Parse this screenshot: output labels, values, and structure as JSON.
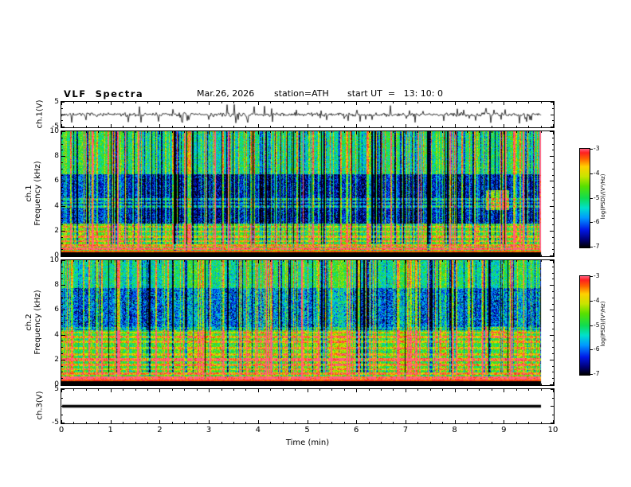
{
  "header": {
    "title": "VLF  Spectra",
    "date": "Mar.26, 2026",
    "station": "station=ATH",
    "start_ut": "start UT  =   13: 10: 0"
  },
  "x_axis": {
    "label": "Time (min)",
    "min": 0,
    "max": 10,
    "ticks": [
      0,
      1,
      2,
      3,
      4,
      5,
      6,
      7,
      8,
      9,
      10
    ],
    "minor_step": 0.25,
    "data_end_min": 9.74
  },
  "colorbars": [
    {
      "label": "log(PSD)/(V²/Hz)",
      "min": -7,
      "max": -3,
      "ticks": [
        -3,
        -4,
        -5,
        -6,
        -7
      ]
    },
    {
      "label": "log(PSD)/(V²/Hz)",
      "min": -7,
      "max": -3,
      "ticks": [
        -3,
        -4,
        -5,
        -6,
        -7
      ]
    }
  ],
  "colormap_stops": [
    {
      "t": 0.0,
      "color": "#000000"
    },
    {
      "t": 0.08,
      "color": "#000078"
    },
    {
      "t": 0.18,
      "color": "#0018e8"
    },
    {
      "t": 0.3,
      "color": "#0098ff"
    },
    {
      "t": 0.4,
      "color": "#00e0cc"
    },
    {
      "t": 0.5,
      "color": "#10dc50"
    },
    {
      "t": 0.62,
      "color": "#58e000"
    },
    {
      "t": 0.72,
      "color": "#c8e400"
    },
    {
      "t": 0.82,
      "color": "#ffd000"
    },
    {
      "t": 0.9,
      "color": "#ff6000"
    },
    {
      "t": 0.96,
      "color": "#ff2020"
    },
    {
      "t": 1.0,
      "color": "#ff6080"
    }
  ],
  "panels": {
    "ch1_wave": {
      "ylabel": "ch.1(V)",
      "ymin": -5,
      "ymax": 5,
      "yticks": [
        {
          "v": 5,
          "label": "5"
        },
        {
          "v": 0,
          "label": ""
        },
        {
          "v": -5,
          "label": "-5"
        }
      ],
      "yminor_step": 2.5
    },
    "ch1_spec": {
      "ylabel_line1": "ch.1",
      "ylabel_line2": "Frequency (kHz)",
      "ymin": 0,
      "ymax": 10,
      "yticks": [
        {
          "v": 10,
          "label": "10"
        },
        {
          "v": 8,
          "label": "8"
        },
        {
          "v": 6,
          "label": "6"
        },
        {
          "v": 4,
          "label": "4"
        },
        {
          "v": 2,
          "label": "2"
        },
        {
          "v": 0,
          "label": "0"
        }
      ],
      "yminor_step": 0.5
    },
    "ch2_spec": {
      "ylabel_line1": "ch.2",
      "ylabel_line2": "Frequency (kHz)",
      "ymin": 0,
      "ymax": 10,
      "yticks": [
        {
          "v": 10,
          "label": "10"
        },
        {
          "v": 8,
          "label": "8"
        },
        {
          "v": 6,
          "label": "6"
        },
        {
          "v": 4,
          "label": "4"
        },
        {
          "v": 2,
          "label": "2"
        },
        {
          "v": 0,
          "label": "0"
        }
      ],
      "yminor_step": 0.5
    },
    "ch3_wave": {
      "ylabel": "ch.3(V)",
      "ymin": -5,
      "ymax": 5,
      "yticks": [
        {
          "v": 5,
          "label": "5"
        },
        {
          "v": 0,
          "label": ""
        },
        {
          "v": -5,
          "label": "-5"
        }
      ],
      "yminor_step": 2.5
    }
  },
  "chart_data": [
    {
      "type": "line",
      "name": "ch1-waveform",
      "ylabel": "ch.1(V)",
      "xlim": [
        0,
        10
      ],
      "ylim": [
        -5,
        5
      ],
      "x_end": 9.74,
      "description": "Noisy broadband voltage trace centred on 0 V, typical excursions about ±1 V with frequent impulsive spikes reaching roughly -4 to +3 V",
      "synthesis": {
        "seed": 7,
        "noise_amp": 0.55,
        "spike_prob": 0.09,
        "spike_min": 1.2,
        "spike_max": 3.4,
        "neg_bias": 0.62
      }
    },
    {
      "type": "heatmap",
      "name": "ch1-spectrogram",
      "ylabel": "ch.1 Frequency (kHz)",
      "zlabel": "log(PSD)/(V²/Hz)",
      "xlim": [
        0,
        10
      ],
      "ylim": [
        0,
        10
      ],
      "zlim": [
        -7,
        -3
      ],
      "x_end": 9.74,
      "description": "VLF spectrogram: green background near -5; dark-blue low-power band 2.6-6.6 kHz; thin cyan horizontal lines near 4 kHz; yellow/orange enhanced lines below 2.5 kHz; black band below 0.3 kHz with a red edge line; dense vertical sferic streaks (bright and dark); greenish enhancement patch 8.6-9.1 min at 3.7-5.3 kHz",
      "synthesis": {
        "seed": 31,
        "base": -5.0,
        "noise": 0.5,
        "bands": [
          {
            "f0": 2.6,
            "f1": 6.6,
            "dv": -1.35,
            "noise": 0.9
          },
          {
            "f0": 6.6,
            "f1": 10.0,
            "dv": -0.1,
            "noise": 0.75
          },
          {
            "f0": 0.3,
            "f1": 2.6,
            "dv": 0.25,
            "noise": 0.6
          }
        ],
        "lines": [
          {
            "f": 3.95,
            "dv": 1.0,
            "w": 0.09
          },
          {
            "f": 4.25,
            "dv": 0.8,
            "w": 0.07
          },
          {
            "f": 4.55,
            "dv": 0.9,
            "w": 0.07
          },
          {
            "f": 2.35,
            "dv": 0.85,
            "w": 0.07
          },
          {
            "f": 1.95,
            "dv": 0.9,
            "w": 0.07
          },
          {
            "f": 1.55,
            "dv": 1.0,
            "w": 0.08
          },
          {
            "f": 1.2,
            "dv": 1.1,
            "w": 0.08
          },
          {
            "f": 0.85,
            "dv": 1.3,
            "w": 0.09
          },
          {
            "f": 0.55,
            "dv": 1.8,
            "w": 0.1
          }
        ],
        "black_band_f": 0.3,
        "edge_line": {
          "f": 0.38,
          "dv_abs": -3.4,
          "w": 0.06
        },
        "streaks": {
          "count": 300,
          "dark_frac": 0.45,
          "amp_min": 0.7,
          "amp_max": 2.1
        },
        "blob": {
          "t0": 8.62,
          "t1": 9.08,
          "f0": 3.7,
          "f1": 5.3,
          "dv": 2.0
        }
      }
    },
    {
      "type": "heatmap",
      "name": "ch2-spectrogram",
      "ylabel": "ch.2 Frequency (kHz)",
      "zlabel": "log(PSD)/(V²/Hz)",
      "xlim": [
        0,
        10
      ],
      "ylim": [
        0,
        10
      ],
      "zlim": [
        -7,
        -3
      ],
      "x_end": 9.74,
      "description": "VLF spectrogram: green background; mottled dark-blue band 4.4-7.8 kHz; many persistent yellow/orange horizontal lines below 4.4 kHz (strong orange band near 2 kHz and red line near 0.5 kHz); black band below 0.3 kHz with red edge line; dense vertical sferic streaks; bright yellow patch 8.6-9.0 min at 3.8-4.7 kHz",
      "synthesis": {
        "seed": 77,
        "base": -5.0,
        "noise": 0.5,
        "bands": [
          {
            "f0": 4.4,
            "f1": 7.8,
            "dv": -0.9,
            "noise": 1.3
          },
          {
            "f0": 7.8,
            "f1": 10.0,
            "dv": -0.1,
            "noise": 0.8
          },
          {
            "f0": 0.3,
            "f1": 4.4,
            "dv": 0.35,
            "noise": 0.7
          }
        ],
        "lines": [
          {
            "f": 4.55,
            "dv": 0.55,
            "w": 0.08
          },
          {
            "f": 4.2,
            "dv": 0.8,
            "w": 0.07
          },
          {
            "f": 3.85,
            "dv": 1.05,
            "w": 0.08
          },
          {
            "f": 3.45,
            "dv": 0.95,
            "w": 0.08
          },
          {
            "f": 2.95,
            "dv": 0.85,
            "w": 0.08
          },
          {
            "f": 2.45,
            "dv": 0.95,
            "w": 0.08
          },
          {
            "f": 2.0,
            "dv": 1.6,
            "w": 0.13
          },
          {
            "f": 1.6,
            "dv": 1.2,
            "w": 0.08
          },
          {
            "f": 1.25,
            "dv": 1.0,
            "w": 0.08
          },
          {
            "f": 0.9,
            "dv": 1.3,
            "w": 0.09
          },
          {
            "f": 0.55,
            "dv": 1.9,
            "w": 0.11
          }
        ],
        "black_band_f": 0.3,
        "edge_line": {
          "f": 0.38,
          "dv_abs": -3.3,
          "w": 0.06
        },
        "streaks": {
          "count": 260,
          "dark_frac": 0.4,
          "amp_min": 0.7,
          "amp_max": 2.0
        },
        "blob": {
          "t0": 8.6,
          "t1": 9.0,
          "f0": 3.8,
          "f1": 4.7,
          "dv": 0.9
        }
      }
    },
    {
      "type": "line",
      "name": "ch3-waveform",
      "ylabel": "ch.3(V)",
      "xlim": [
        0,
        10
      ],
      "ylim": [
        -5,
        5
      ],
      "x_end": 9.74,
      "constant_value": 0,
      "description": "Flat trace at 0 V for the whole record, drawn as a thick black line",
      "synthesis": {
        "line_width": 3.5
      }
    }
  ]
}
